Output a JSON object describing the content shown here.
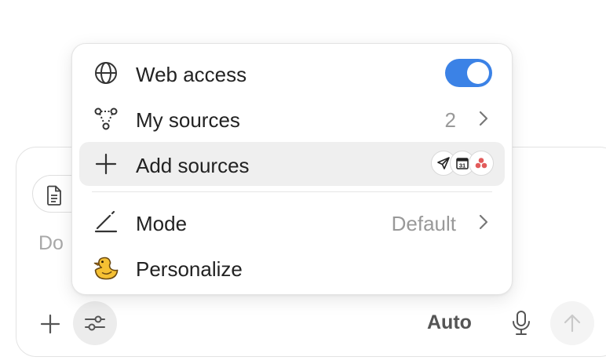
{
  "colors": {
    "toggle_on": "#3b82e6",
    "hover_row": "#efefef",
    "pinwheel_red": "#e25b5b"
  },
  "composer": {
    "placeholder": "Do",
    "model_label": "Auto"
  },
  "menu": {
    "web_access": {
      "label": "Web access",
      "icon": "globe-icon",
      "enabled": true
    },
    "my_sources": {
      "label": "My sources",
      "icon": "nodes-icon",
      "count": "2"
    },
    "add_sources": {
      "label": "Add sources",
      "icon": "plus-icon",
      "connectors": [
        {
          "icon": "send-icon"
        },
        {
          "icon": "calendar-icon",
          "text": "31"
        },
        {
          "icon": "asana-icon"
        }
      ]
    },
    "mode": {
      "label": "Mode",
      "icon": "pen-icon",
      "value": "Default"
    },
    "personalize": {
      "label": "Personalize",
      "icon": "duck-icon"
    }
  }
}
